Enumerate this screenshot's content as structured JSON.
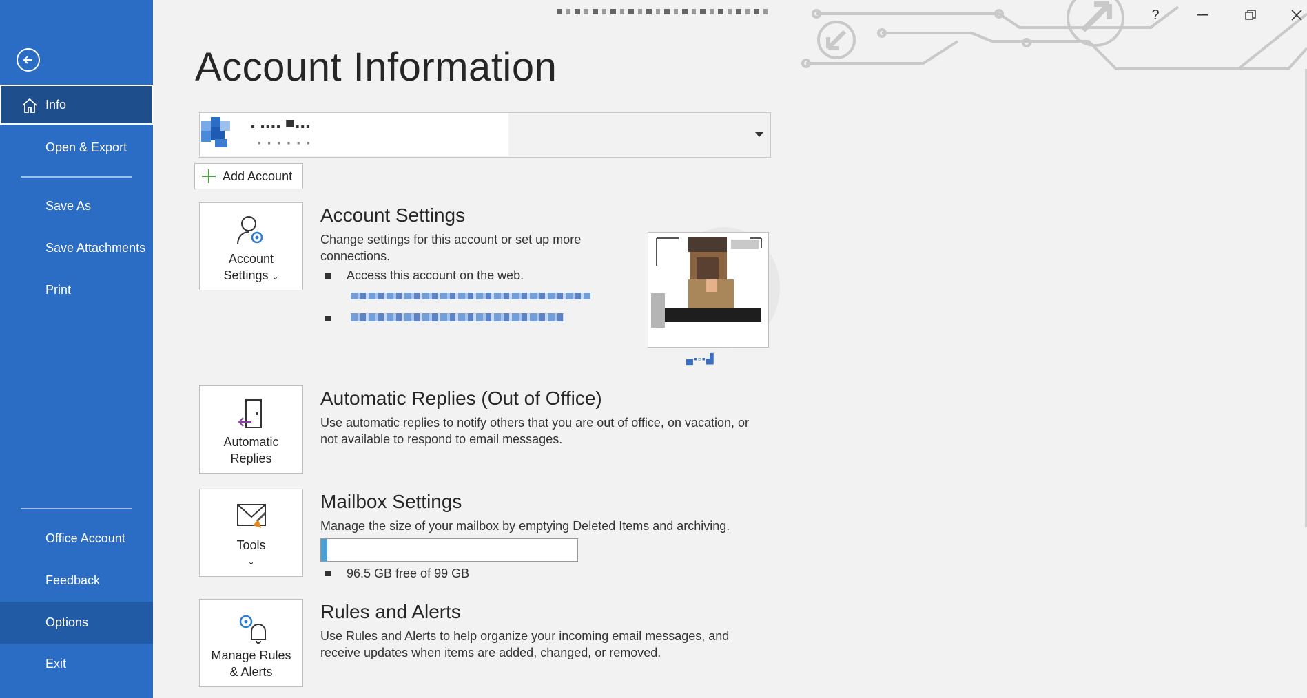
{
  "sidebar": {
    "items": [
      {
        "label": "Info",
        "icon": "home-icon"
      },
      {
        "label": "Open & Export"
      },
      {
        "label": "Save As"
      },
      {
        "label": "Save Attachments"
      },
      {
        "label": "Print"
      },
      {
        "label": "Office Account"
      },
      {
        "label": "Feedback"
      },
      {
        "label": "Options"
      },
      {
        "label": "Exit"
      }
    ],
    "selected": "Info",
    "hovered": "Options"
  },
  "main": {
    "title": "Account Information",
    "add_account": "Add Account",
    "account_settings": {
      "tile_label_1": "Account",
      "tile_label_2": "Settings",
      "title": "Account Settings",
      "desc": "Change settings for this account or set up more connections.",
      "bullet1": "Access this account on the web."
    },
    "auto_replies": {
      "tile_label_1": "Automatic",
      "tile_label_2": "Replies",
      "title": "Automatic Replies (Out of Office)",
      "desc": "Use automatic replies to notify others that you are out of office, on vacation, or not available to respond to email messages."
    },
    "mailbox": {
      "tile_label": "Tools",
      "title": "Mailbox Settings",
      "desc": "Manage the size of your mailbox by emptying Deleted Items and archiving.",
      "storage_text": "96.5 GB free of 99 GB",
      "used_fraction": 0.025
    },
    "rules": {
      "tile_label_1": "Manage Rules",
      "tile_label_2": "& Alerts",
      "title": "Rules and Alerts",
      "desc": "Use Rules and Alerts to help organize your incoming email messages, and receive updates when items are added, changed, or removed."
    }
  },
  "window": {
    "help": "?",
    "minimize": "—",
    "close": "✕"
  },
  "colors": {
    "sidebar": "#2b6cc4",
    "sidebar_selected": "#1e4e8c",
    "accent_green": "#4c9e46",
    "progress": "#4aa0d3"
  }
}
